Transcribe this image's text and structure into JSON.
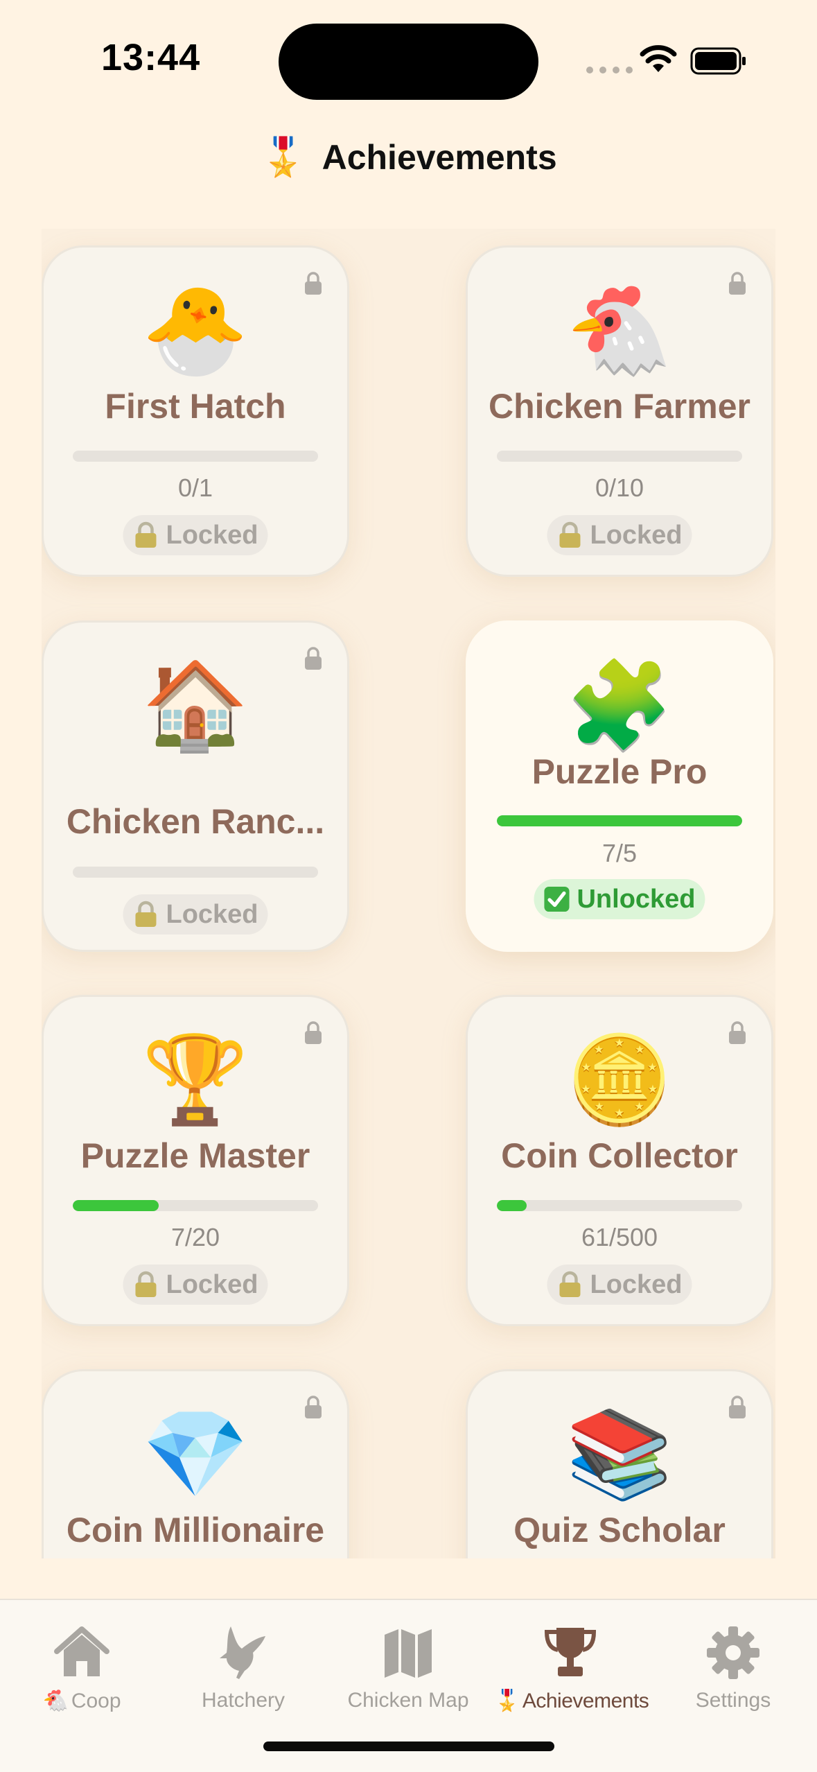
{
  "status_bar": {
    "time": "13:44"
  },
  "header": {
    "medal_emoji": "🎖️",
    "title": "Achievements"
  },
  "achievements": [
    {
      "emoji": "🐣",
      "name": "First Hatch",
      "progress_text": "0/1",
      "progress": 0,
      "status": "Locked",
      "status_emoji": "🔒"
    },
    {
      "emoji": "🐔",
      "name": "Chicken Farmer",
      "progress_text": "0/10",
      "progress": 0,
      "status": "Locked",
      "status_emoji": "🔒"
    },
    {
      "emoji": "🏠",
      "name": "Chicken Ranc...",
      "progress_text": "",
      "progress": 0,
      "status": "Locked",
      "status_emoji": "🔒"
    },
    {
      "emoji": "🧩",
      "name": "Puzzle Pro",
      "progress_text": "7/5",
      "progress": 1.0,
      "status": "Unlocked",
      "status_emoji": "✅"
    },
    {
      "emoji": "🏆",
      "name": "Puzzle Master",
      "progress_text": "7/20",
      "progress": 0.35,
      "status": "Locked",
      "status_emoji": "🔒"
    },
    {
      "emoji": "🪙",
      "name": "Coin Collector",
      "progress_text": "61/500",
      "progress": 0.122,
      "status": "Locked",
      "status_emoji": "🔒"
    },
    {
      "emoji": "💎",
      "name": "Coin Millionaire"
    },
    {
      "emoji": "📚",
      "name": "Quiz Scholar"
    }
  ],
  "tabbar": {
    "tabs": [
      {
        "label": "Coop",
        "emoji": "🐔",
        "icon": "house-icon"
      },
      {
        "label": "Hatchery",
        "icon": "bird-icon"
      },
      {
        "label": "Chicken Map",
        "icon": "map-icon"
      },
      {
        "label": "Achievements",
        "emoji": "🎖️",
        "icon": "trophy-icon",
        "active": true
      },
      {
        "label": "Settings",
        "icon": "gear-icon"
      }
    ]
  },
  "colors": {
    "background": "#FFF3E3",
    "accent": "#6E4A3C",
    "progress": "#3CC63C",
    "card_title": "#8E6A5B"
  }
}
